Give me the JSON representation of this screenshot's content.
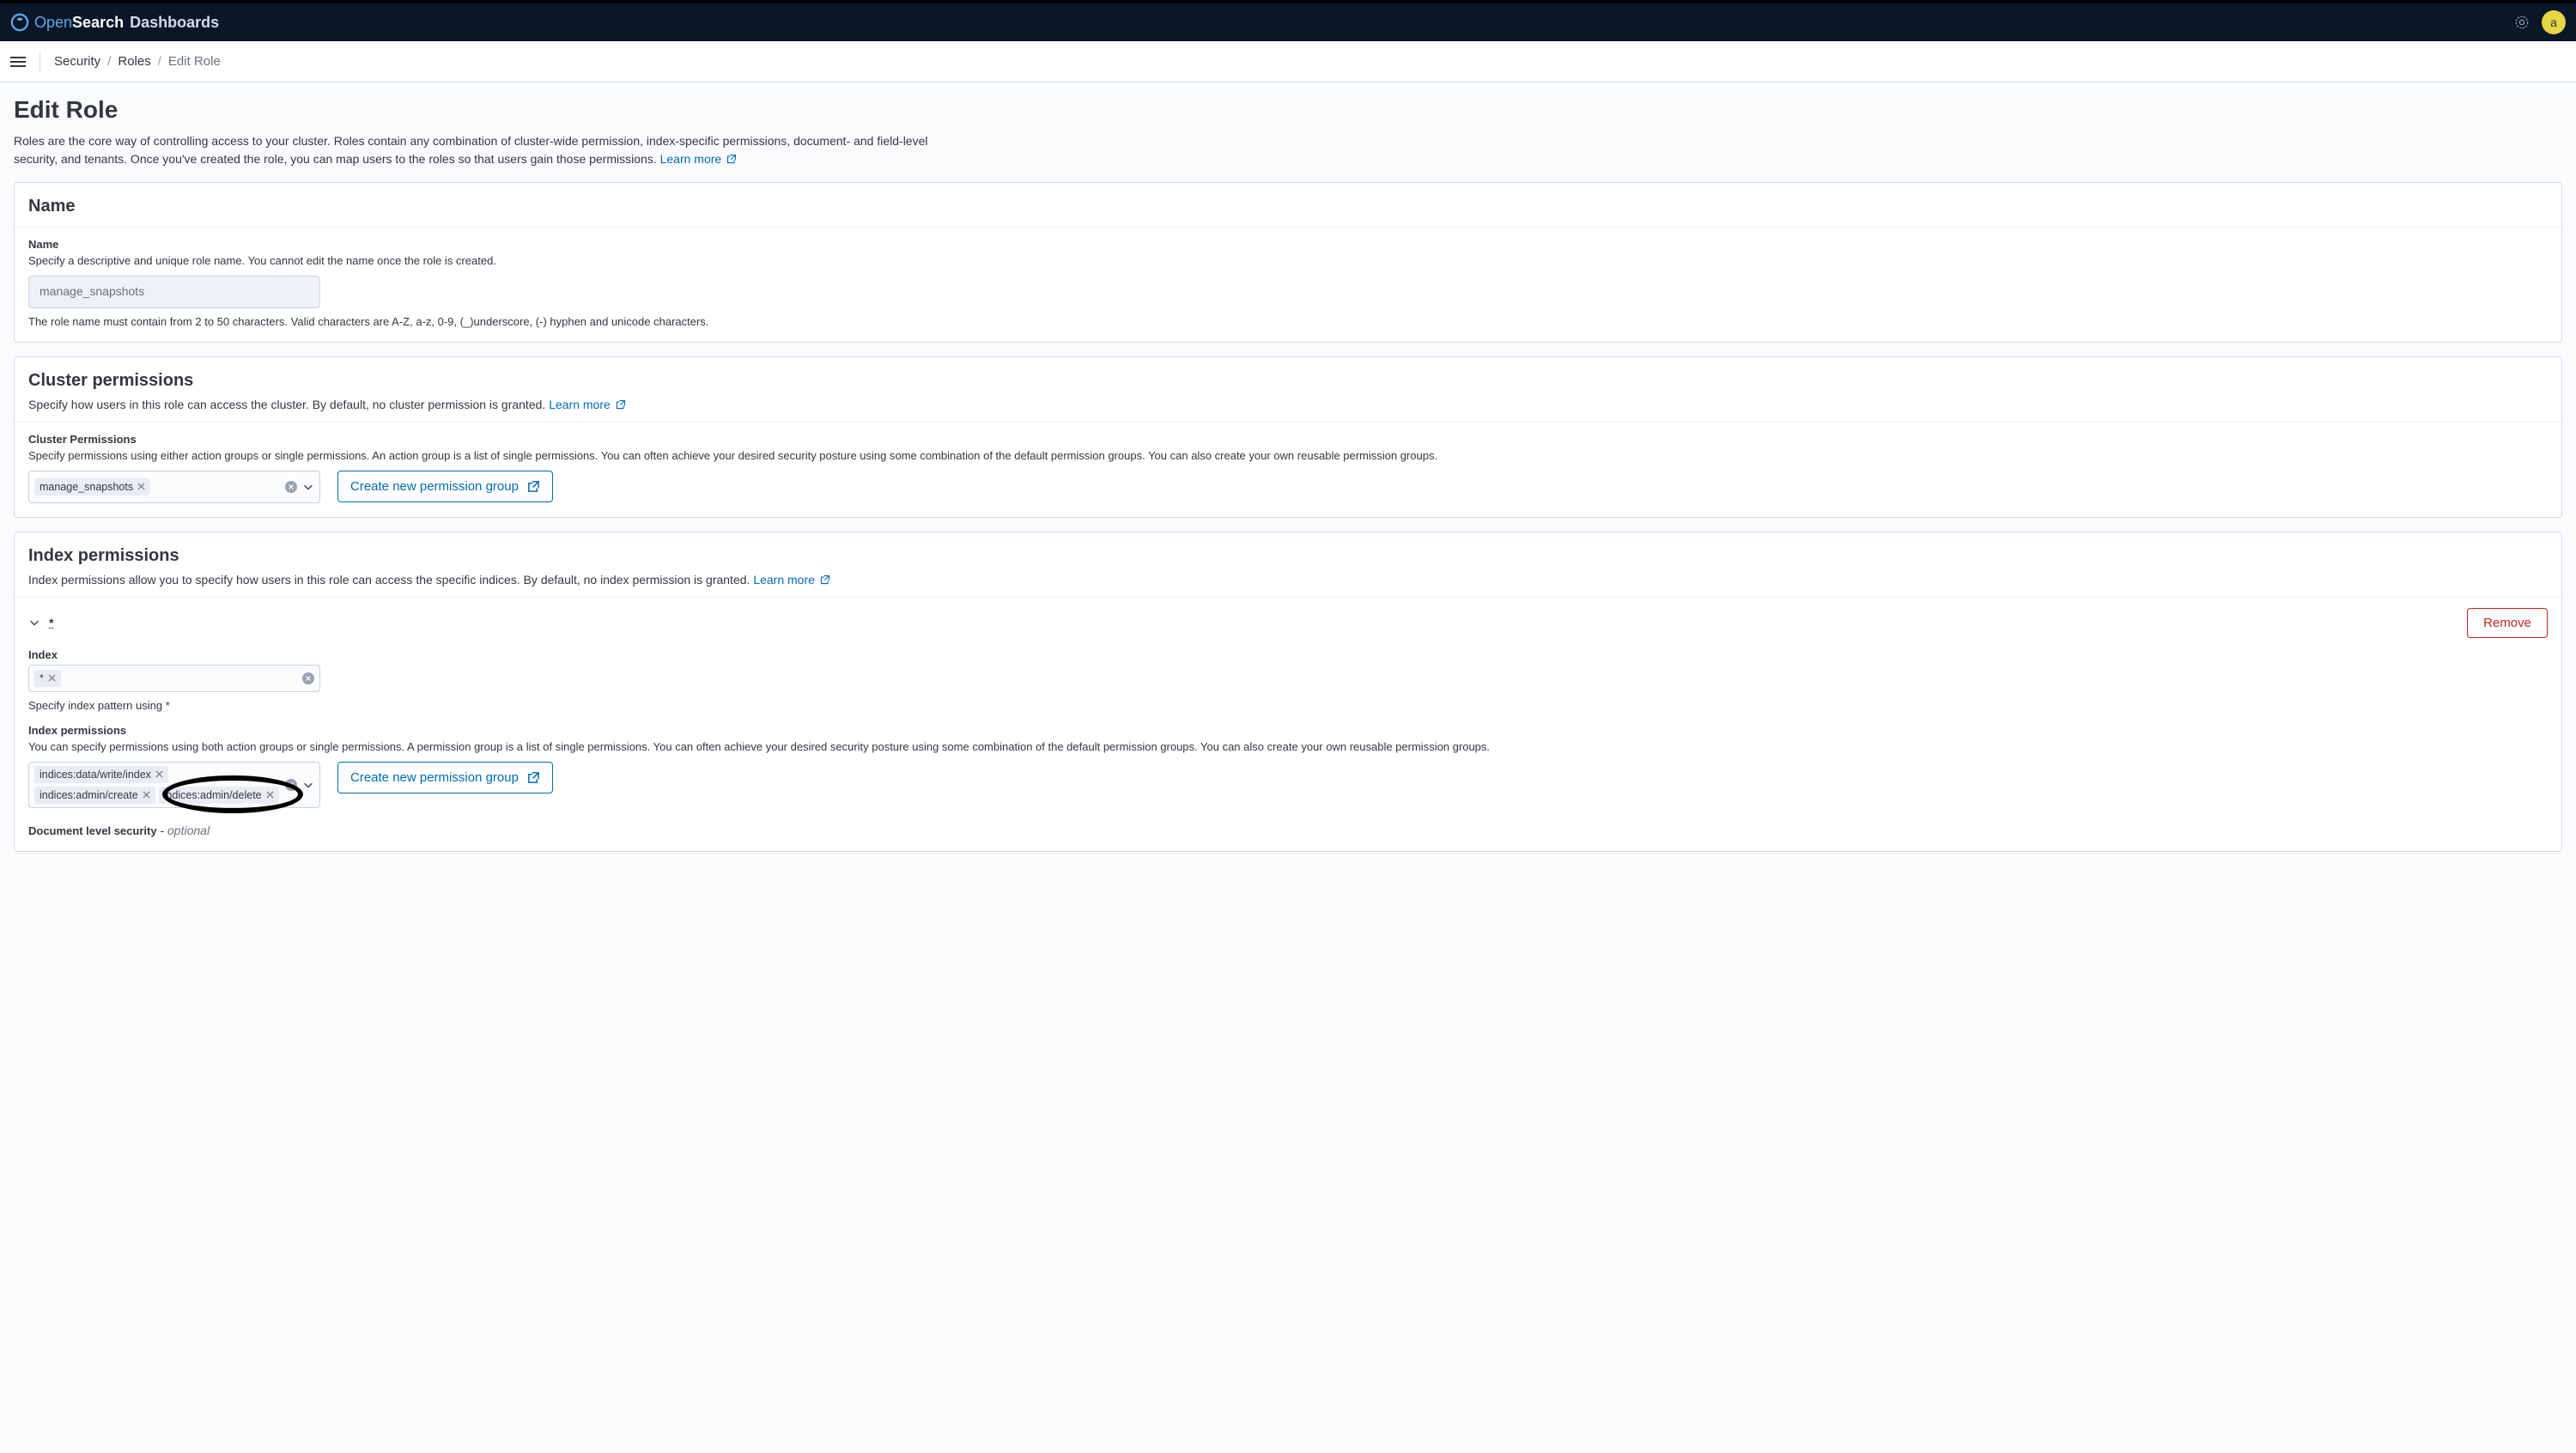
{
  "topbar": {
    "brand_open": "Open",
    "brand_search": "Search",
    "brand_dash": "Dashboards",
    "avatar_letter": "a"
  },
  "breadcrumbs": {
    "items": [
      "Security",
      "Roles",
      "Edit Role"
    ]
  },
  "page": {
    "title": "Edit Role",
    "description": "Roles are the core way of controlling access to your cluster. Roles contain any combination of cluster-wide permission, index-specific permissions, document- and field-level security, and tenants. Once you've created the role, you can map users to the roles so that users gain those permissions. ",
    "learn_more": "Learn more"
  },
  "name_section": {
    "title": "Name",
    "field_label": "Name",
    "field_help": "Specify a descriptive and unique role name. You cannot edit the name once the role is created.",
    "value": "manage_snapshots",
    "note": "The role name must contain from 2 to 50 characters. Valid characters are A-Z, a-z, 0-9, (_)underscore, (-) hyphen and unicode characters."
  },
  "cluster_section": {
    "title": "Cluster permissions",
    "sub": "Specify how users in this role can access the cluster. By default, no cluster permission is granted. ",
    "learn_more": "Learn more",
    "field_label": "Cluster Permissions",
    "field_help": "Specify permissions using either action groups or single permissions. An action group is a list of single permissions. You can often achieve your desired security posture using some combination of the default permission groups. You can also create your own reusable permission groups.",
    "pills": [
      "manage_snapshots"
    ],
    "create_btn": "Create new permission group"
  },
  "index_section": {
    "title": "Index permissions",
    "sub": "Index permissions allow you to specify how users in this role can access the specific indices. By default, no index permission is granted. ",
    "learn_more": "Learn more",
    "accordion_label": "*",
    "remove_btn": "Remove",
    "index_label": "Index",
    "index_pills": [
      "*"
    ],
    "index_note": "Specify index pattern using *",
    "perm_label": "Index permissions",
    "perm_help": "You can specify permissions using both action groups or single permissions. A permission group is a list of single permissions. You can often achieve your desired security posture using some combination of the default permission groups. You can also create your own reusable permission groups.",
    "perm_pills": [
      "indices:data/write/index",
      "indices:admin/create",
      "indices:admin/delete"
    ],
    "create_btn": "Create new permission group",
    "dls_label": "Document level security",
    "dls_suffix": " - ",
    "dls_optional": "optional"
  }
}
